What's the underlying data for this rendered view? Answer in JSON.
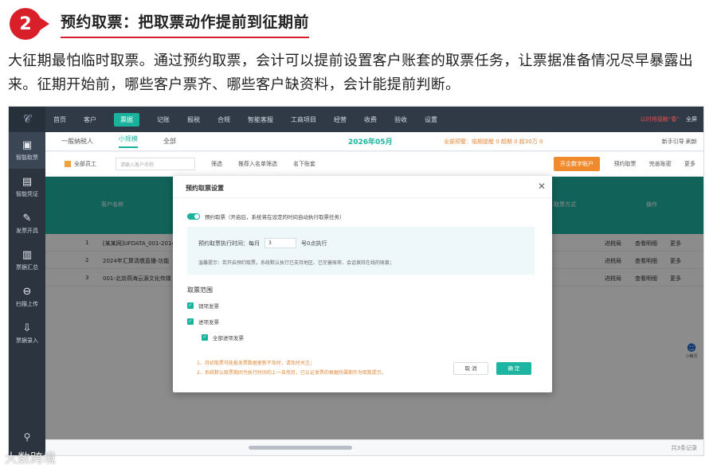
{
  "article": {
    "step_number": "2",
    "step_title": "预约取票：把取票动作提前到征期前",
    "paragraph": "大征期最怕临时取票。通过预约取票，会计可以提前设置客户账套的取票任务，让票据准备情况尽早暴露出来。征期开始前，哪些客户票齐、哪些客户缺资料，会计能提前判断。"
  },
  "sidebar": {
    "items": [
      {
        "icon": "▣",
        "label": "智能取票"
      },
      {
        "icon": "▤",
        "label": "智能凭证"
      },
      {
        "icon": "✎",
        "label": "发票开具"
      },
      {
        "icon": "▥",
        "label": "票据汇总"
      },
      {
        "icon": "⊖",
        "label": "扫描上传"
      },
      {
        "icon": "⇩",
        "label": "票据录入"
      }
    ]
  },
  "topnav": {
    "items": [
      "首页",
      "客户",
      "票据",
      "记账",
      "报税",
      "合规",
      "智能客服",
      "工商项目",
      "经营",
      "收费",
      "验收",
      "设置"
    ],
    "active": "票据",
    "promo": "以时将接触“春”",
    "fullscreen": "全屏"
  },
  "tabbar": {
    "tabs": [
      "一般纳税人",
      "小规模",
      "全部"
    ],
    "period": "2026年05月",
    "warning": "全部预警：临期提醒 0   超期 0   超30万 0",
    "right": "新手引导   刷新"
  },
  "toolbar": {
    "all_staff": "全部员工",
    "search_placeholder": "请输入客户名称",
    "filter": "筛选",
    "recommend": "推荐入名单筛选",
    "nonbilling": "名下账套",
    "orange_btn": "开企数字账户",
    "reserve": "预约取票",
    "complete": "完善账密",
    "more": "更多"
  },
  "table": {
    "columns": [
      "客户名称",
      "取票方式",
      "操作"
    ],
    "rows": [
      {
        "no": "1",
        "name": "[某某网]UFDATA_001-2014",
        "actions": [
          "进税局",
          "查看明细",
          "更多"
        ]
      },
      {
        "no": "2",
        "name": "2024年汇算清缴直播-功能",
        "actions": [
          "进税局",
          "查看明细",
          "更多"
        ]
      },
      {
        "no": "3",
        "name": "001-北京燕海云源文化传媒",
        "actions": [
          "进税局",
          "查看明细",
          "更多"
        ]
      }
    ],
    "pagination": "共3条记录"
  },
  "modal": {
    "title": "预约取票设置",
    "switch_label": "预约取票（开启后，系统将在设定的时间自动执行取票任务）",
    "exec_time_label": "预约取票执行时间：每月",
    "day_value": "3",
    "exec_suffix": "号0点执行",
    "tip": "温馨提示：若开启预约取票，系统默认执行已支持地区、已完善账密、会话保持在线的账套；",
    "scope_title": "取票范围",
    "scope_items": [
      "销项发票",
      "进项发票",
      "全部进项发票"
    ],
    "notes": [
      "1、月初取票可能报发票数据更新不及时，请及时关注；",
      "2、系统默认取票期间为执行时间的上一自然月，已认证发票的根据所属期作为取数提示。"
    ],
    "cancel": "取 消",
    "confirm": "确 定"
  },
  "watermark": "大数跨境",
  "colors": {
    "accent": "#19b39d",
    "step_red": "#d9202a",
    "warning_orange": "#e08a3c"
  }
}
